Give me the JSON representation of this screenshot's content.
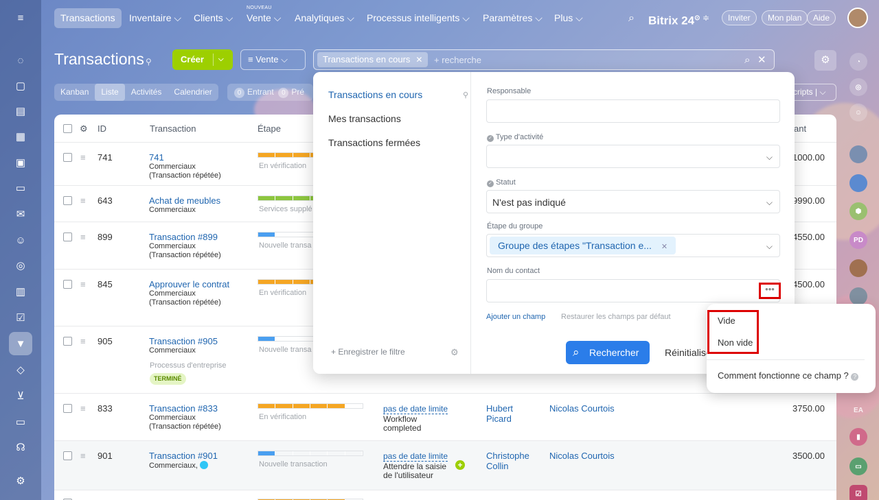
{
  "nav": {
    "items": [
      "Transactions",
      "Inventaire ⌵",
      "Clients ⌵",
      "Vente ⌵",
      "Analytiques ⌵",
      "Processus intelligents ⌵",
      "Paramètres ⌵",
      "Plus ⌵"
    ],
    "badge": "NOUVEAU",
    "logo": "Bitrix 24",
    "logo_mark": "⊙",
    "invite": "Inviter",
    "plan": "Mon plan",
    "help": "Aide"
  },
  "header": {
    "title": "Transactions",
    "create": "Créer",
    "pipeline": "Vente",
    "search_chip": "Transactions en cours",
    "search_placeholder": "+ recherche",
    "scripts": "cripts"
  },
  "view_tabs": [
    "Kanban",
    "Liste",
    "Activités",
    "Calendrier"
  ],
  "counters": {
    "entrant_count": "0",
    "entrant": "Entrant",
    "planned_count": "0",
    "planned": "Pré"
  },
  "grid": {
    "columns": {
      "id": "ID",
      "deal": "Transaction",
      "stage": "Étape",
      "amount": "ant"
    },
    "rows": [
      {
        "id": "741",
        "title": "741",
        "sub1": "Commerciaux",
        "sub2": "(Transaction répétée)",
        "stage": "En vérification",
        "amount": "1000.00"
      },
      {
        "id": "643",
        "title": "Achat de meubles",
        "sub1": "Commerciaux",
        "sub2": "",
        "stage": "Services supplé",
        "amount": "9990.00"
      },
      {
        "id": "899",
        "title": "Transaction #899",
        "sub1": "Commerciaux",
        "sub2": "(Transaction répétée)",
        "stage": "Nouvelle transa",
        "amount": "4550.00"
      },
      {
        "id": "845",
        "title": "Approuver le contrat",
        "sub1": "Commerciaux",
        "sub2": "(Transaction répétée)",
        "stage": "En vérification",
        "amount": "4500.00"
      },
      {
        "id": "905",
        "title": "Transaction #905",
        "sub1": "Commerciaux",
        "sub2": "",
        "stage": "Nouvelle transa",
        "amount": "",
        "process": "Processus d'entreprise",
        "status": "TERMINÉ"
      },
      {
        "id": "833",
        "title": "Transaction #833",
        "sub1": "Commerciaux",
        "sub2": "(Transaction répétée)",
        "stage": "En vérification",
        "deadline": "pas de date limite",
        "activity1": "Workflow",
        "activity2": "completed",
        "resp1": "Hubert",
        "resp2": "Picard",
        "contact": "Nicolas Courtois",
        "amount": "3750.00"
      },
      {
        "id": "901",
        "title": "Transaction #901",
        "sub1": "Commerciaux,",
        "sub2": "",
        "stage": "Nouvelle transaction",
        "deadline": "pas de date limite",
        "activity1": "Attendre la saisie",
        "activity2": "de l'utilisateur",
        "resp1": "Christophe",
        "resp2": "Collin",
        "contact": "Nicolas Courtois",
        "amount": "3500.00"
      }
    ]
  },
  "filter": {
    "presets": [
      "Transactions en cours",
      "Mes transactions",
      "Transactions fermées"
    ],
    "save": "+ Enregistrer le filtre",
    "fields": {
      "responsible": "Responsable",
      "activity_type": "Type d'activité",
      "status": "Statut",
      "status_value": "N'est pas indiqué",
      "stage_group": "Étape du groupe",
      "stage_group_value": "Groupe des étapes \"Transaction e...",
      "contact_name": "Nom du contact"
    },
    "add_field": "Ajouter un champ",
    "restore": "Restaurer les champs par défaut",
    "search": "Rechercher",
    "reset": "Réinitialiser"
  },
  "popup": {
    "items": [
      "Vide",
      "Non vide"
    ],
    "help": "Comment fonctionne ce champ ?"
  },
  "rightbar": {
    "pd": "PD",
    "ea": "EA"
  },
  "colors": {
    "accent": "#2066b0",
    "create": "#9dcf00",
    "search_btn": "#2b7de9",
    "highlight": "#dd0000"
  }
}
